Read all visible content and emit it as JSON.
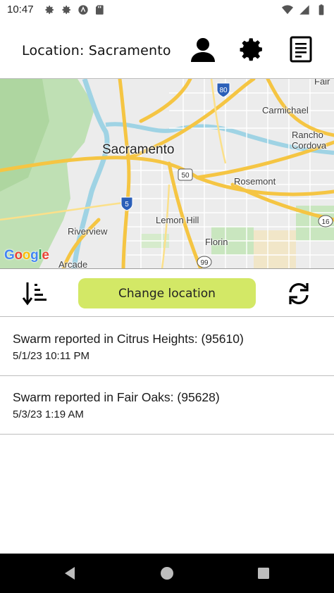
{
  "status_bar": {
    "time": "10:47",
    "left_icons": [
      "settings-gear-icon",
      "settings-gear-icon",
      "android-a-icon",
      "sd-card-icon"
    ],
    "right_icons": [
      "wifi-icon",
      "cellular-signal-icon",
      "battery-icon"
    ]
  },
  "header": {
    "location_label": "Location: Sacramento",
    "buttons": [
      "account-icon",
      "settings-icon",
      "report-list-icon"
    ]
  },
  "map": {
    "labels": {
      "sacramento": "Sacramento",
      "carmichael": "Carmichael",
      "rancho_cordova": "Rancho\nCordova",
      "rosemont": "Rosemont",
      "lemon_hill": "Lemon Hill",
      "riverview": "Riverview",
      "florin": "Florin",
      "arcade": "Arcade",
      "fair_oaks": "Fair"
    },
    "shields": {
      "i80": "80",
      "us50": "50",
      "i5": "5",
      "sr99": "99",
      "sr16": "16"
    },
    "attribution": "Google",
    "colors": {
      "land": "#ececec",
      "green": "#b9dcb0",
      "water": "#9fd3e4",
      "highway": "#f5c543",
      "road": "#ffffff"
    }
  },
  "toolbar": {
    "sort_icon": "sort-icon",
    "change_location_label": "Change location",
    "refresh_icon": "refresh-icon",
    "button_color": "#d3e866"
  },
  "reports": [
    {
      "title": "Swarm reported in Citrus Heights: (95610)",
      "time": "5/1/23 10:11 PM"
    },
    {
      "title": "Swarm reported in Fair Oaks: (95628)",
      "time": "5/3/23 1:19 AM"
    }
  ],
  "nav_bar": {
    "buttons": [
      "back-icon",
      "home-icon",
      "recents-icon"
    ]
  }
}
